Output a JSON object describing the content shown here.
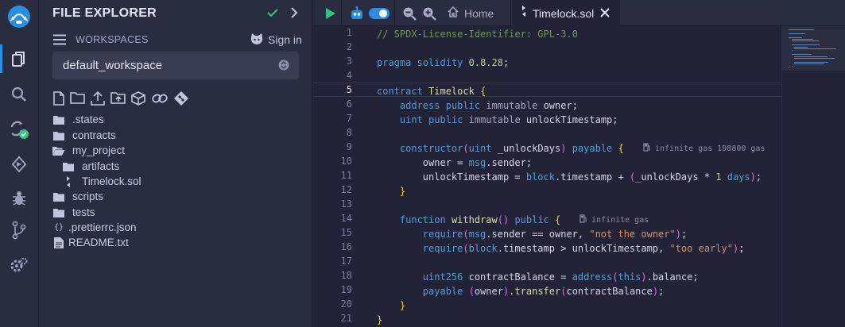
{
  "panel": {
    "title": "FILE EXPLORER",
    "workspaces_label": "WORKSPACES",
    "sign_in_label": "Sign in",
    "workspace_selected": "default_workspace"
  },
  "tree": [
    {
      "name": ".states",
      "type": "folder"
    },
    {
      "name": "contracts",
      "type": "folder"
    },
    {
      "name": "my_project",
      "type": "folder-open"
    },
    {
      "name": "artifacts",
      "type": "folder"
    },
    {
      "name": "Timelock.sol",
      "type": "sol"
    },
    {
      "name": "scripts",
      "type": "folder"
    },
    {
      "name": "tests",
      "type": "folder"
    },
    {
      "name": ".prettierrc.json",
      "type": "json"
    },
    {
      "name": "README.txt",
      "type": "file"
    }
  ],
  "tabs": {
    "home_label": "Home",
    "file_label": "Timelock.sol"
  },
  "editor": {
    "active_line": 5,
    "line_numbers": [
      "1",
      "2",
      "3",
      "4",
      "5",
      "6",
      "7",
      "8",
      "9",
      "10",
      "11",
      "12",
      "13",
      "14",
      "15",
      "16",
      "17",
      "18",
      "19",
      "20",
      "21"
    ],
    "lines": [
      "// SPDX-License-Identifier: GPL-3.0",
      "",
      "pragma solidity 0.8.28;",
      "",
      "contract Timelock {",
      "    address public immutable owner;",
      "    uint public immutable unlockTimestamp;",
      "",
      "    constructor(uint _unlockDays) payable {",
      "        owner = msg.sender;",
      "        unlockTimestamp = block.timestamp + (_unlockDays * 1 days);",
      "    }",
      "",
      "    function withdraw() public {",
      "        require(msg.sender == owner, \"not the owner\");",
      "        require(block.timestamp > unlockTimestamp, \"too early\");",
      "",
      "        uint256 contractBalance = address(this).balance;",
      "        payable (owner).transfer(contractBalance);",
      "    }",
      "}"
    ],
    "gas_constructor": "infinite gas 198800 gas",
    "gas_withdraw": "infinite gas"
  },
  "colors": {
    "accent": "#2a8fe0",
    "keyword": "#569cd6",
    "comment": "#6a9955",
    "string": "#ce9178",
    "success": "#33c481"
  },
  "icons": {
    "rail": [
      "remix-logo-icon",
      "file-explorer-icon",
      "search-icon",
      "solidity-compiler-icon",
      "deploy-run-icon",
      "debugger-icon",
      "git-icon",
      "settings-icon"
    ],
    "toolbar": [
      "new-file-icon",
      "new-folder-icon",
      "upload-file-icon",
      "upload-folder-icon",
      "import-workspace-icon",
      "link-icon",
      "git-clone-icon"
    ]
  }
}
